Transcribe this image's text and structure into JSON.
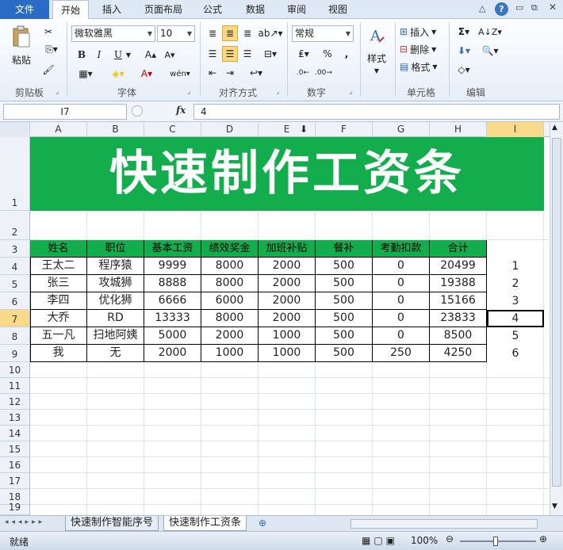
{
  "ribbon_tabs": [
    "文件",
    "开始",
    "插入",
    "页面布局",
    "公式",
    "数据",
    "审阅",
    "视图"
  ],
  "groups": {
    "clipboard": {
      "label": "剪贴板",
      "paste": "粘贴"
    },
    "font": {
      "label": "字体",
      "font_name": "微软雅黑",
      "font_size": "10",
      "bold": "B",
      "italic": "I",
      "underline": "U"
    },
    "alignment": {
      "label": "对齐方式"
    },
    "number": {
      "label": "数字",
      "format": "常规"
    },
    "styles": {
      "label": "样式"
    },
    "cells": {
      "label": "单元格",
      "insert": "插入",
      "delete": "删除",
      "format": "格式"
    },
    "editing": {
      "label": "编辑"
    }
  },
  "formula_bar": {
    "name_box": "I7",
    "fx": "fx",
    "formula": "4"
  },
  "columns": [
    "A",
    "B",
    "C",
    "D",
    "E",
    "F",
    "G",
    "H",
    "I"
  ],
  "rows": [
    "1",
    "2",
    "3",
    "4",
    "5",
    "6",
    "7",
    "8",
    "9",
    "10",
    "11",
    "12",
    "13",
    "14",
    "15",
    "16",
    "17",
    "18",
    "19"
  ],
  "title": "快速制作工资条",
  "table": {
    "headers": [
      "姓名",
      "职位",
      "基本工资",
      "绩效奖金",
      "加班补贴",
      "餐补",
      "考勤扣款",
      "合计"
    ],
    "rows": [
      [
        "王太二",
        "程序猿",
        "9999",
        "8000",
        "2000",
        "500",
        "0",
        "20499"
      ],
      [
        "张三",
        "攻城狮",
        "8888",
        "8000",
        "2000",
        "500",
        "0",
        "19388"
      ],
      [
        "李四",
        "优化狮",
        "6666",
        "6000",
        "2000",
        "500",
        "0",
        "15166"
      ],
      [
        "大乔",
        "RD",
        "13333",
        "8000",
        "2000",
        "500",
        "0",
        "23833"
      ],
      [
        "五一凡",
        "扫地阿姨",
        "5000",
        "2000",
        "1000",
        "500",
        "0",
        "8500"
      ],
      [
        "我",
        "无",
        "2000",
        "1000",
        "1000",
        "500",
        "250",
        "4250"
      ]
    ],
    "index_col": [
      "1",
      "2",
      "3",
      "4",
      "5",
      "6"
    ]
  },
  "sheets": [
    "快速制作智能序号",
    "快速制作工资条"
  ],
  "status": {
    "mode": "就绪",
    "zoom": "100%"
  },
  "colors": {
    "accent_green": "#13ad4d",
    "file_tab": "#2a6bc5"
  }
}
